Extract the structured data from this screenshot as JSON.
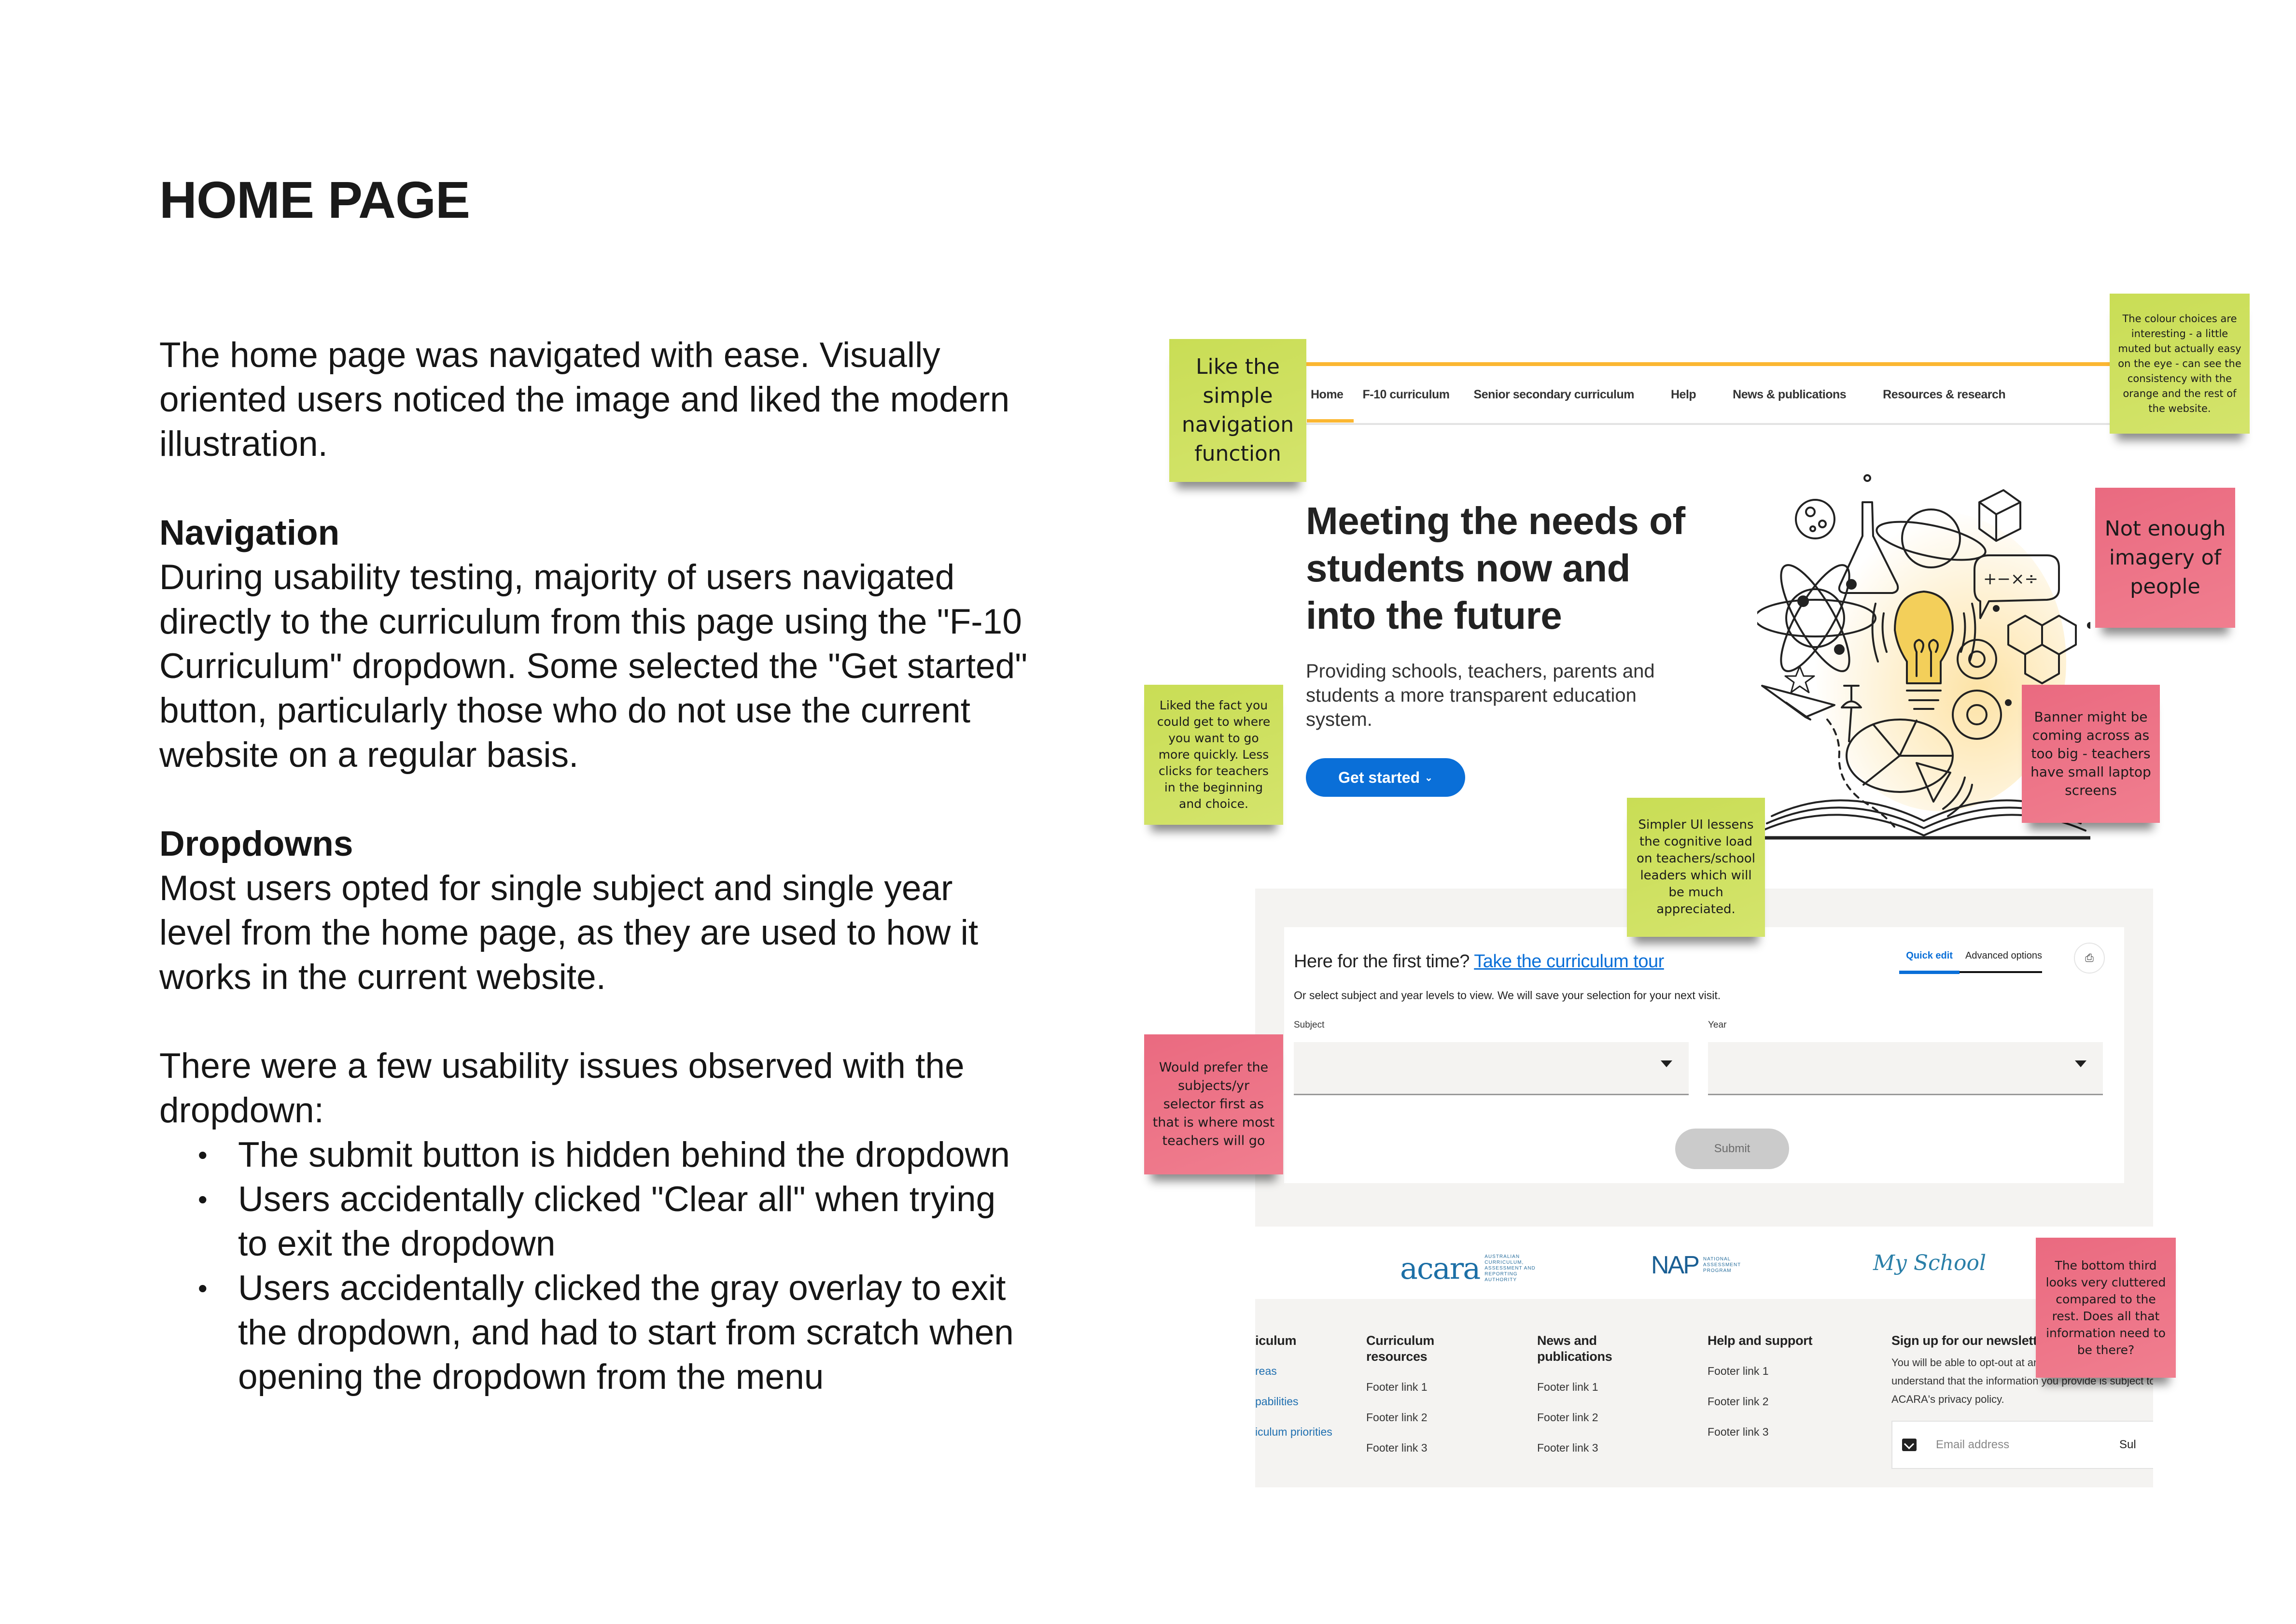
{
  "report": {
    "title": "HOME PAGE",
    "intro": "The home page was navigated with ease. Visually oriented users noticed the image and liked the modern illustration.",
    "sections": [
      {
        "heading": "Navigation",
        "body": "During usability testing, majority of users navigated directly to the curriculum from this page using the \"F-10 Curriculum\" dropdown. Some selected the \"Get started\" button, particularly those who do not use the current website on a regular basis."
      },
      {
        "heading": "Dropdowns",
        "body": "Most users opted for single subject and single year level from the home page, as they are used to how it works in the current website."
      }
    ],
    "issues_intro": "There were a few usability issues observed with the dropdown:",
    "issues": [
      "The submit button is hidden behind the dropdown",
      "Users accidentally clicked \"Clear all\" when trying to exit the dropdown",
      "Users accidentally clicked the gray overlay to exit the dropdown, and had to start from scratch when opening the dropdown from the menu"
    ]
  },
  "site": {
    "nav": {
      "items": [
        "Home",
        "F-10 curriculum",
        "Senior secondary curriculum",
        "Help",
        "News & publications",
        "Resources & research"
      ],
      "active": "Home"
    },
    "hero": {
      "title": "Meeting the needs of students now and into the future",
      "subtitle": "Providing schools, teachers, parents and students a more transparent education system.",
      "cta_label": "Get started",
      "cta_icon": "chevron-down-icon",
      "illustration": "open-book-science-doodles"
    },
    "form": {
      "heading_prefix": "Here for the first time?",
      "tour_link": "Take the curriculum tour",
      "tabs": [
        "Quick edit",
        "Advanced options"
      ],
      "active_tab": "Quick edit",
      "print_icon": "printer-icon",
      "help_text": "Or select subject and year levels to view. We will save your selection for your next visit.",
      "subject_label": "Subject",
      "subject_value": "",
      "year_label": "Year",
      "year_value": "",
      "submit_label": "Submit"
    },
    "logos": {
      "acara": "acara",
      "acara_sub": "Australian Curriculum, Assessment and Reporting Authority",
      "nap": "NAP",
      "nap_sub": "National Assessment Program",
      "myschool": "My School"
    },
    "footer": {
      "columns": [
        {
          "heading": "iculum",
          "links": [
            "reas",
            "pabilities",
            "iculum priorities"
          ]
        },
        {
          "heading": "Curriculum resources",
          "links": [
            "Footer link 1",
            "Footer link 2",
            "Footer link 3"
          ]
        },
        {
          "heading": "News and publications",
          "links": [
            "Footer link 1",
            "Footer link 2",
            "Footer link 3"
          ]
        },
        {
          "heading": "Help and support",
          "links": [
            "Footer link 1",
            "Footer link 2",
            "Footer link 3"
          ]
        }
      ],
      "newsletter": {
        "heading": "Sign up for our newsletter",
        "text": "You will be able to opt-out at any time. By signing up you understand that the information you provide is subject to ACARA's privacy policy.",
        "email_placeholder": "Email address",
        "subscribe_label": "Sul"
      }
    }
  },
  "notes": [
    {
      "id": "nav",
      "color": "green",
      "text": "Like the simple navigation function"
    },
    {
      "id": "colour",
      "color": "green",
      "text": "The colour choices are interesting - a little muted but actually easy on the eye - can see the consistency with the orange and the rest of the website."
    },
    {
      "id": "imagery",
      "color": "pink",
      "text": "Not enough imagery of people"
    },
    {
      "id": "quick",
      "color": "green",
      "text": "Liked the fact you could get to where you want to go more quickly. Less clicks for teachers in the beginning and choice."
    },
    {
      "id": "banner",
      "color": "pink",
      "text": "Banner might be coming across as too big - teachers have small laptop screens"
    },
    {
      "id": "simpler",
      "color": "green",
      "text": "Simpler UI lessens the cognitive load on teachers/school leaders which will be much appreciated."
    },
    {
      "id": "selector",
      "color": "pink",
      "text": "Would prefer the subjects/yr selector first as that is where most teachers will go"
    },
    {
      "id": "bottom",
      "color": "pink",
      "text": "The bottom third looks very cluttered compared to the rest. Does all that information need to be there?"
    }
  ],
  "colors": {
    "accent_orange": "#fbb732",
    "primary_blue": "#0a6fd8",
    "note_green": "#cadd58",
    "note_pink": "#ee7185"
  }
}
